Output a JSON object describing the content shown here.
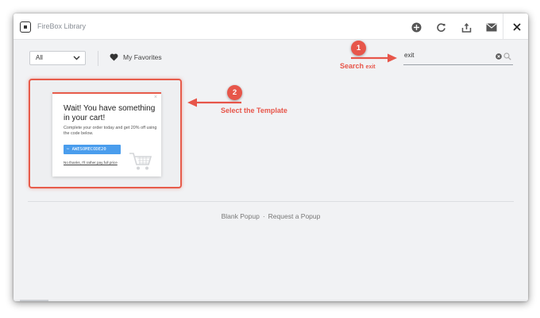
{
  "window": {
    "app_title": "FireBox Library",
    "toolbar_icons": [
      "plus-circle-icon",
      "refresh-icon",
      "upload-icon",
      "mail-icon",
      "close-icon"
    ]
  },
  "filters": {
    "category_value": "All",
    "favorites_label": "My Favorites"
  },
  "search": {
    "value": "exit",
    "placeholder": ""
  },
  "template_card": {
    "title": "Wait! You have something in your cart!",
    "body": "Complete your order today and get 20% off using the code below.",
    "coupon_code": "AWESOMECODE20",
    "coupon_icon": "scissors-icon",
    "decline_link": "No thanks, I'll rather pay full price",
    "close_glyph": "×"
  },
  "footer": {
    "blank_popup": "Blank Popup",
    "separator": "·",
    "request_popup": "Request a Popup"
  },
  "annotations": {
    "step1_number": "1",
    "step1_label": "Search",
    "step1_term": "exit",
    "step2_number": "2",
    "step2_label": "Select the Template"
  },
  "colors": {
    "accent_red": "#e7564a",
    "coupon_blue": "#4a9ded",
    "window_bg": "#f1f2f4"
  }
}
